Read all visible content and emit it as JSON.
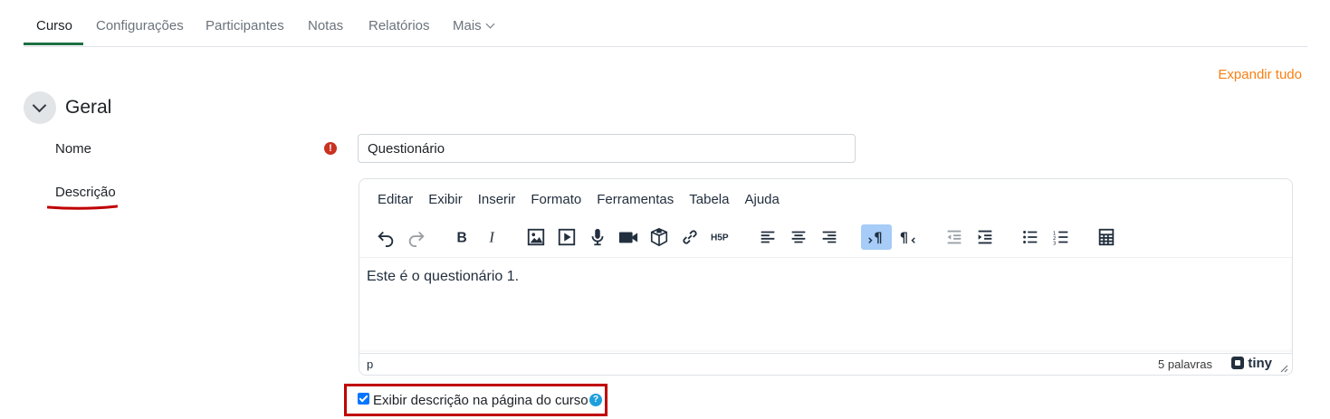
{
  "tabs": [
    {
      "label": "Curso",
      "active": true
    },
    {
      "label": "Configurações",
      "active": false
    },
    {
      "label": "Participantes",
      "active": false
    },
    {
      "label": "Notas",
      "active": false
    },
    {
      "label": "Relatórios",
      "active": false
    },
    {
      "label": "Mais",
      "active": false
    }
  ],
  "expand_all": "Expandir tudo",
  "section": {
    "title": "Geral"
  },
  "form": {
    "name_label": "Nome",
    "name_value": "Questionário",
    "required_icon": "!",
    "description_label": "Descrição"
  },
  "editor": {
    "menu": [
      "Editar",
      "Exibir",
      "Inserir",
      "Formato",
      "Ferramentas",
      "Tabela",
      "Ajuda"
    ],
    "content": "Este é o questionário 1.",
    "path": "p",
    "word_count": "5 palavras",
    "brand": "tiny",
    "toolbar_icons": [
      "undo-icon",
      "redo-icon",
      "bold-icon",
      "italic-icon",
      "image-icon",
      "media-icon",
      "record-audio-icon",
      "record-video-icon",
      "h5p-content-bank-icon",
      "link-icon",
      "h5p-icon",
      "align-left-icon",
      "align-center-icon",
      "align-right-icon",
      "ltr-icon",
      "rtl-icon",
      "outdent-icon",
      "indent-icon",
      "bullet-list-icon",
      "numbered-list-icon",
      "equation-editor-icon"
    ]
  },
  "show_description": {
    "label": "Exibir descrição na página do curso",
    "checked": true,
    "help_icon": "?"
  },
  "colors": {
    "accent": "#f98012",
    "highlight": "#c00000",
    "checkbox": "#0075ff",
    "help": "#1f9fdc",
    "required": "#ca3120"
  }
}
